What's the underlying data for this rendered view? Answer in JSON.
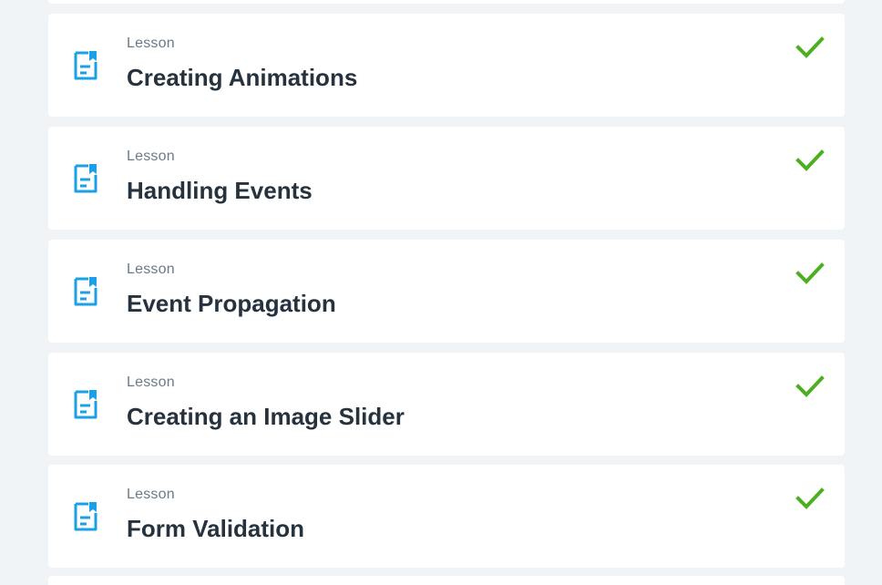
{
  "colors": {
    "page_background": "#f1f4f6",
    "card_background": "#ffffff",
    "icon_blue": "#1aa0e6",
    "check_green": "#4caf1f",
    "label_gray": "#6b7a8a",
    "title_dark": "#26323d"
  },
  "lessons": [
    {
      "type_label": "Lesson",
      "title": "Creating Animations",
      "icon": "lesson-document-icon",
      "status": "completed",
      "status_icon": "checkmark-icon"
    },
    {
      "type_label": "Lesson",
      "title": "Handling Events",
      "icon": "lesson-document-icon",
      "status": "completed",
      "status_icon": "checkmark-icon"
    },
    {
      "type_label": "Lesson",
      "title": "Event Propagation",
      "icon": "lesson-document-icon",
      "status": "completed",
      "status_icon": "checkmark-icon"
    },
    {
      "type_label": "Lesson",
      "title": "Creating an Image Slider",
      "icon": "lesson-document-icon",
      "status": "completed",
      "status_icon": "checkmark-icon"
    },
    {
      "type_label": "Lesson",
      "title": "Form Validation",
      "icon": "lesson-document-icon",
      "status": "completed",
      "status_icon": "checkmark-icon"
    }
  ]
}
